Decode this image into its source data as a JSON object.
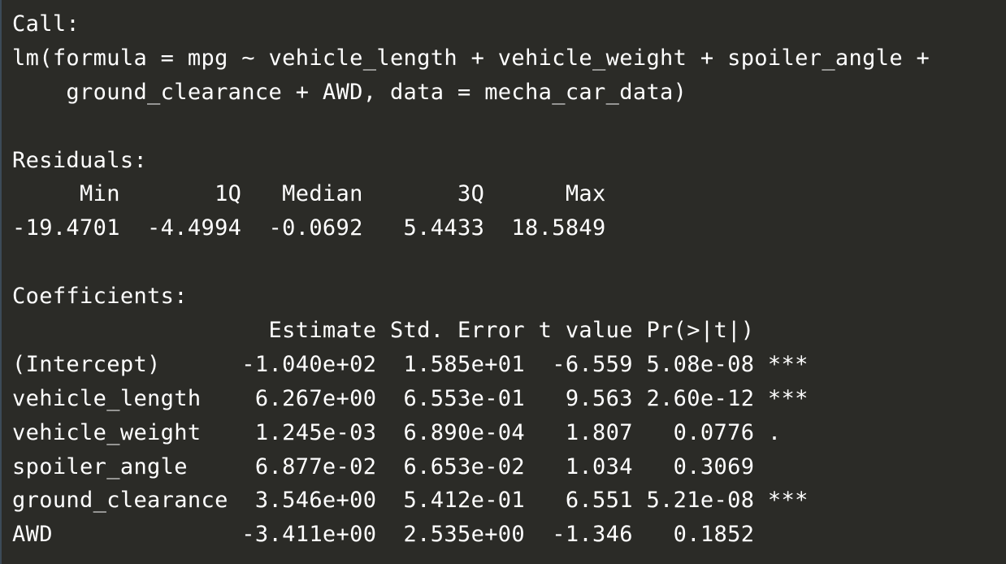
{
  "console": {
    "lines": [
      "Call:",
      "lm(formula = mpg ~ vehicle_length + vehicle_weight + spoiler_angle +",
      "    ground_clearance + AWD, data = mecha_car_data)",
      "",
      "Residuals:",
      "     Min       1Q   Median       3Q      Max ",
      "-19.4701  -4.4994  -0.0692   5.4433  18.5849 ",
      "",
      "Coefficients:",
      "                   Estimate Std. Error t value Pr(>|t|)    ",
      "(Intercept)      -1.040e+02  1.585e+01  -6.559 5.08e-08 ***",
      "vehicle_length    6.267e+00  6.553e-01   9.563 2.60e-12 ***",
      "vehicle_weight    1.245e-03  6.890e-04   1.807   0.0776 .  ",
      "spoiler_angle     6.877e-02  6.653e-02   1.034   0.3069    ",
      "ground_clearance  3.546e+00  5.412e-01   6.551 5.21e-08 ***",
      "AWD              -3.411e+00  2.535e+00  -1.346   0.1852    "
    ]
  },
  "colors": {
    "background": "#2b2b27",
    "text": "#ffffff",
    "left_border": "#3c4a58"
  }
}
